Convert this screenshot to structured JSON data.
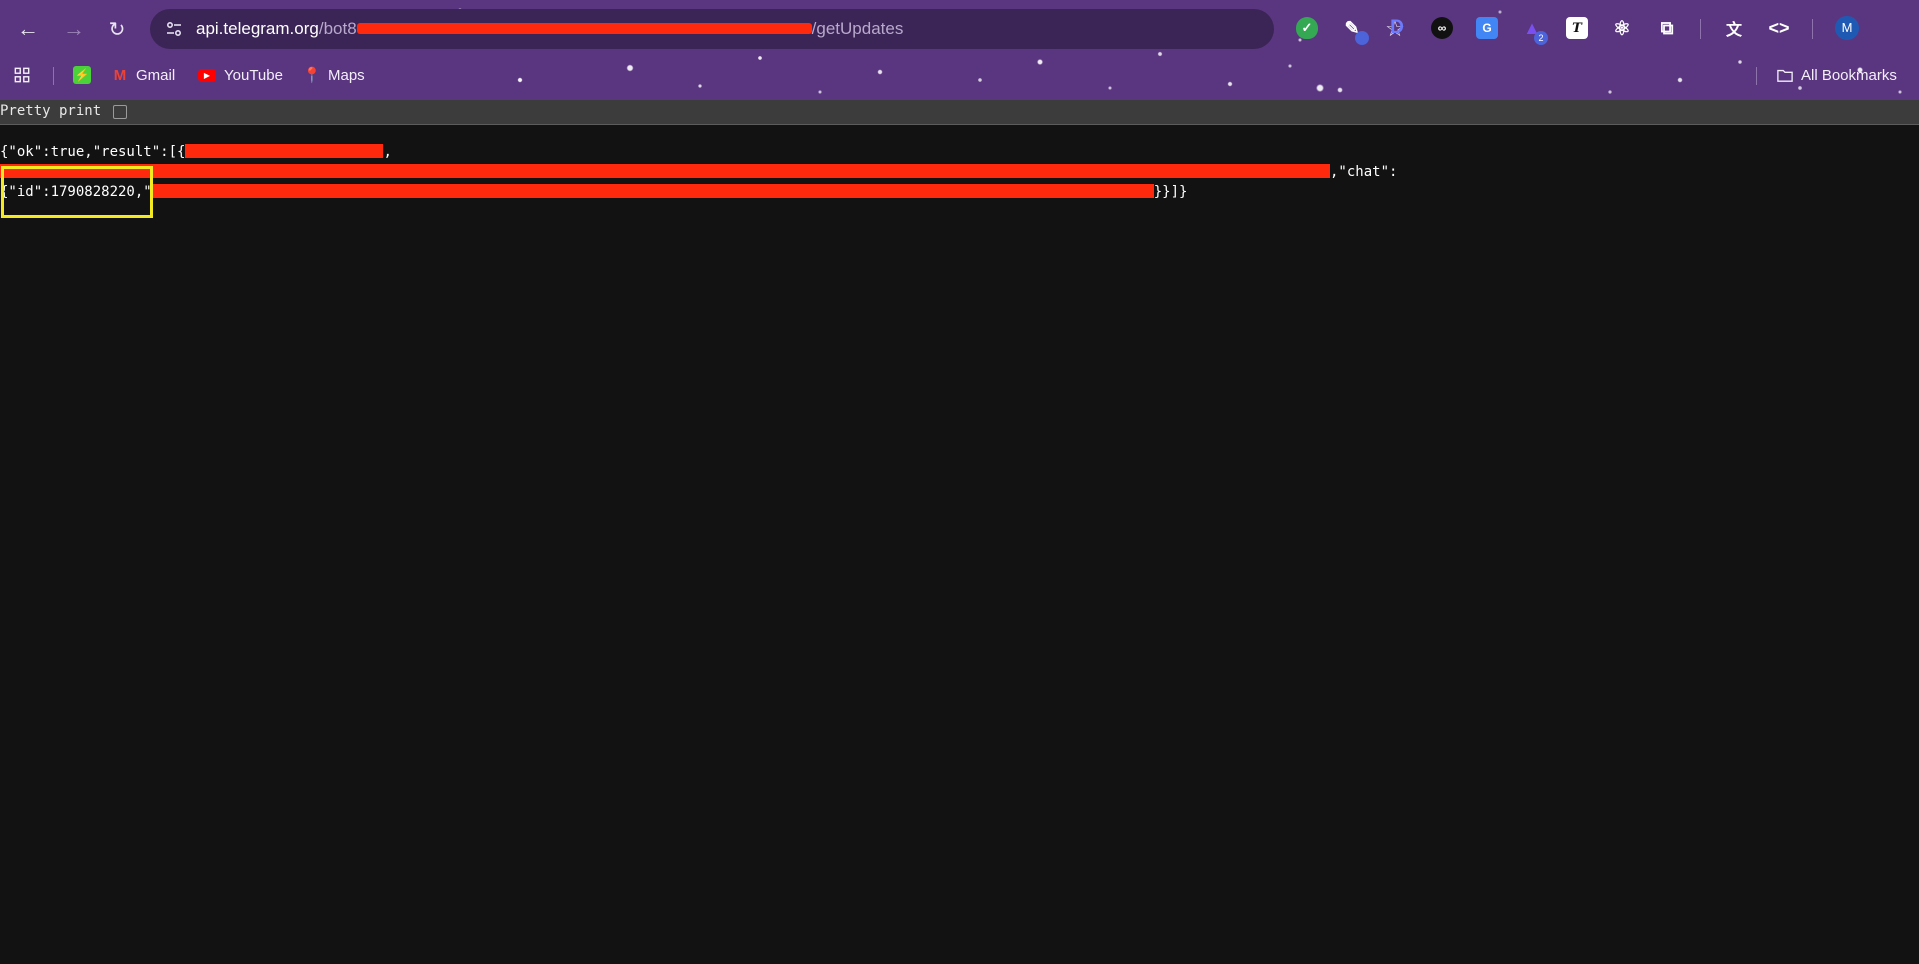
{
  "browser": {
    "url": {
      "host": "api.telegram.org",
      "path_start": "/bot8",
      "path_end": "/getUpdates"
    },
    "extensions": [
      {
        "name": "shield-extension",
        "glyph": "✓",
        "color": "#34a853"
      },
      {
        "name": "picker-extension",
        "glyph": "✎",
        "color": "#ffffff"
      },
      {
        "name": "d-extension",
        "glyph": "D",
        "color": "#5b6ef5"
      },
      {
        "name": "mask-extension",
        "glyph": "◎",
        "color": "#ffffff"
      },
      {
        "name": "translate-extension",
        "glyph": "G",
        "color": "#4285f4"
      },
      {
        "name": "academic-extension",
        "glyph": "▲",
        "color": "#6a3fd1",
        "badge": "2"
      },
      {
        "name": "text-extension",
        "glyph": "T",
        "color": "#ffffff"
      },
      {
        "name": "react-extension",
        "glyph": "⚛",
        "color": "#ffffff"
      },
      {
        "name": "extensions-puzzle",
        "glyph": "⧉",
        "color": "#ffffff"
      }
    ],
    "avatar_initial": "M",
    "bookmarks": [
      {
        "label": "Gmail"
      },
      {
        "label": "YouTube"
      },
      {
        "label": "Maps"
      }
    ],
    "all_bookmarks_label": "All Bookmarks"
  },
  "page": {
    "pretty_print_label": "Pretty print",
    "json_line1_prefix": "{\"ok\":true,\"result\":[{",
    "json_line1_tail": ",",
    "json_line2_suffix": ",\"chat\":",
    "json_line3_prefix": "{\"id\":1790828220,\"",
    "json_line3_suffix": "}}]}"
  },
  "colors": {
    "redaction": "#ff2a0e",
    "highlight": "#f3ea20",
    "toolbar": "#5a3680"
  }
}
